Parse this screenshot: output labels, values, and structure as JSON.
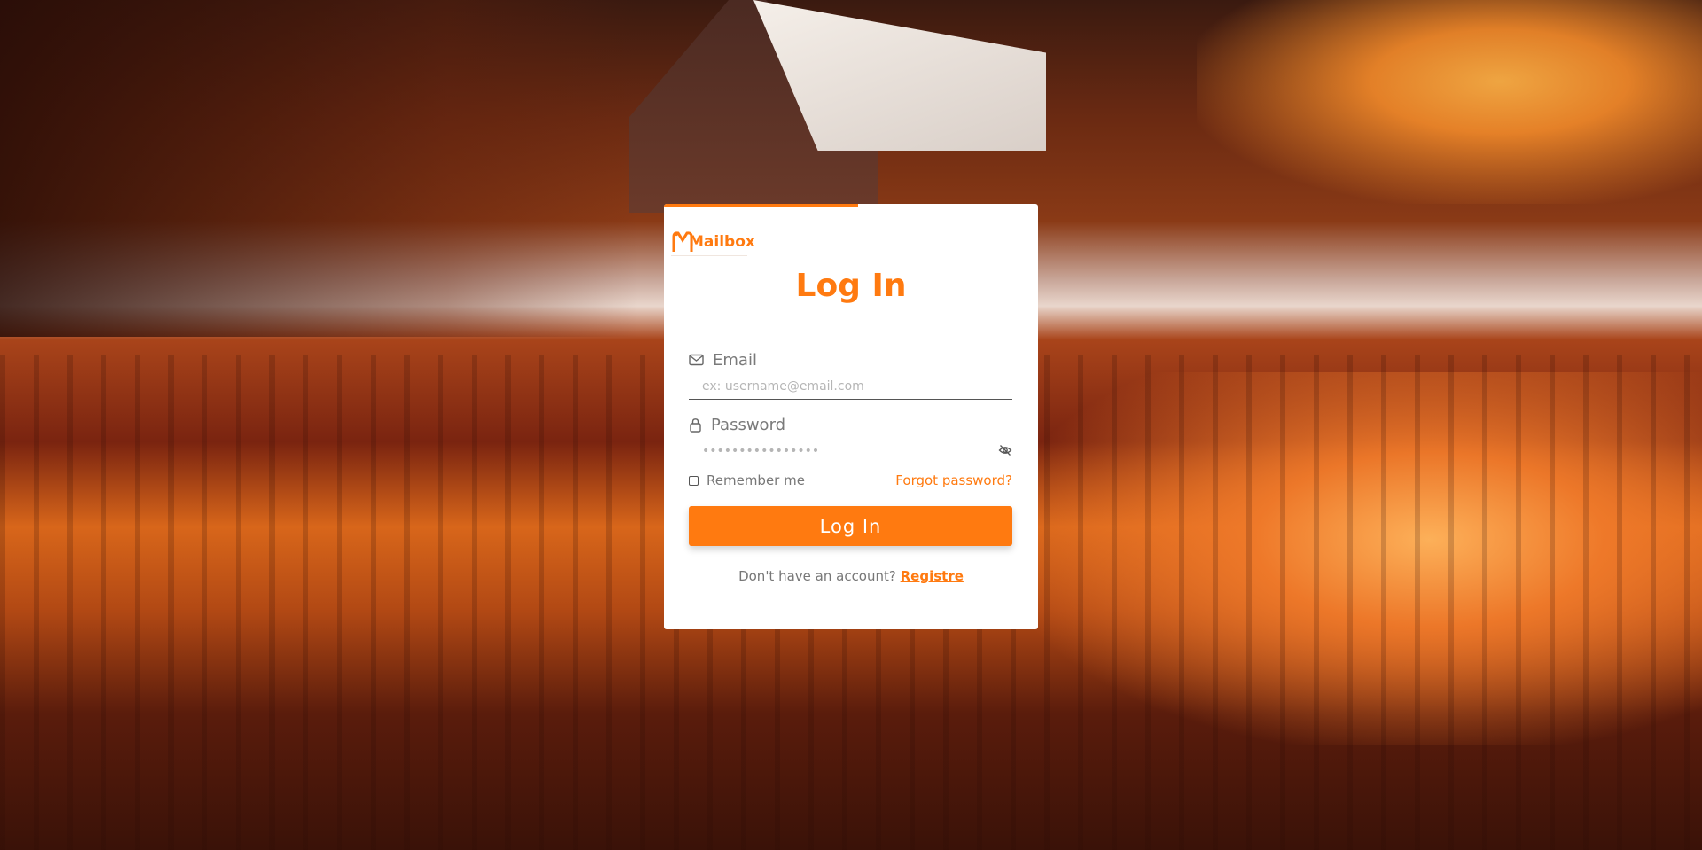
{
  "brand": {
    "name": "Mailbox",
    "accent_color": "#ff7a10"
  },
  "progress": {
    "fraction": 0.52
  },
  "login": {
    "title": "Log In",
    "email": {
      "label": "Email",
      "icon": "envelope-icon",
      "placeholder": "ex: username@email.com",
      "value": ""
    },
    "password": {
      "label": "Password",
      "icon": "lock-icon",
      "placeholder": "••••••••••••••••",
      "value": "",
      "toggle_icon": "eye-off-icon"
    },
    "remember_label": "Remember me",
    "remember_checked": false,
    "forgot_label": "Forgot password?",
    "submit_label": "Log In",
    "signup_prompt": "Don't have an account?",
    "signup_link": "Registre"
  }
}
